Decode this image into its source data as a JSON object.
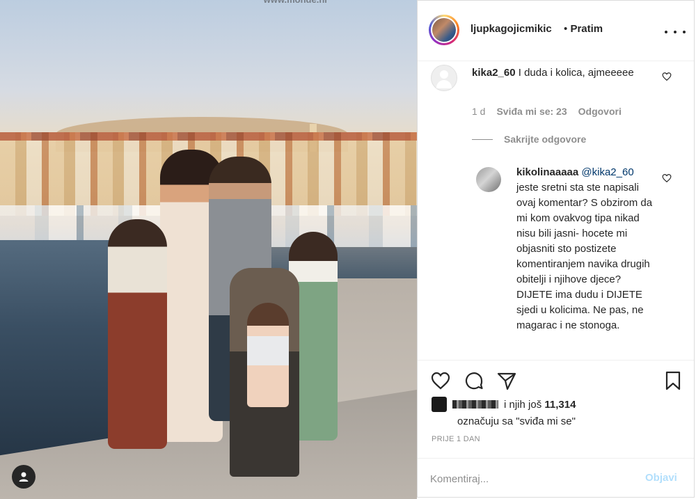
{
  "photo": {
    "watermark": "www.monde.hr",
    "user_tag_icon": "person-icon"
  },
  "header": {
    "username": "ljupkagojicmikic",
    "separator": "•",
    "follow_status": "Pratim",
    "more_icon": "more-dots-icon"
  },
  "comments": {
    "first": {
      "username": "kika2_60",
      "text": "I duda i kolica, ajmeeeee",
      "age": "1 d",
      "likes": "Sviđa mi se: 23",
      "reply_label": "Odgovori"
    },
    "hide_replies_label": "Sakrijte odgovore",
    "reply": {
      "username": "kikolinaaaaa",
      "mention": "@kika2_60",
      "text": "jeste sretni sta ste napisali ovaj komentar? S obzirom da mi kom ovakvog tipa nikad nisu bili jasni- hocete mi objasniti sto postizete komentiranjem navika drugih obitelji i njihove djece? DIJETE ima dudu i DIJETE sjedi u kolicima. Ne pas, ne magarac i ne stonoga."
    }
  },
  "actions": {
    "likes_prefix": "i njih još",
    "likes_count": "11,314",
    "likes_suffix": "označuju sa \"sviđa mi se\"",
    "timestamp": "PRIJE 1 DAN"
  },
  "comment_bar": {
    "placeholder": "Komentiraj...",
    "post_label": "Objavi"
  },
  "colors": {
    "text": "#262626",
    "secondary": "#8e8e8e",
    "link": "#00376b",
    "post_disabled": "#b2dffc",
    "border": "#dbdbdb"
  }
}
